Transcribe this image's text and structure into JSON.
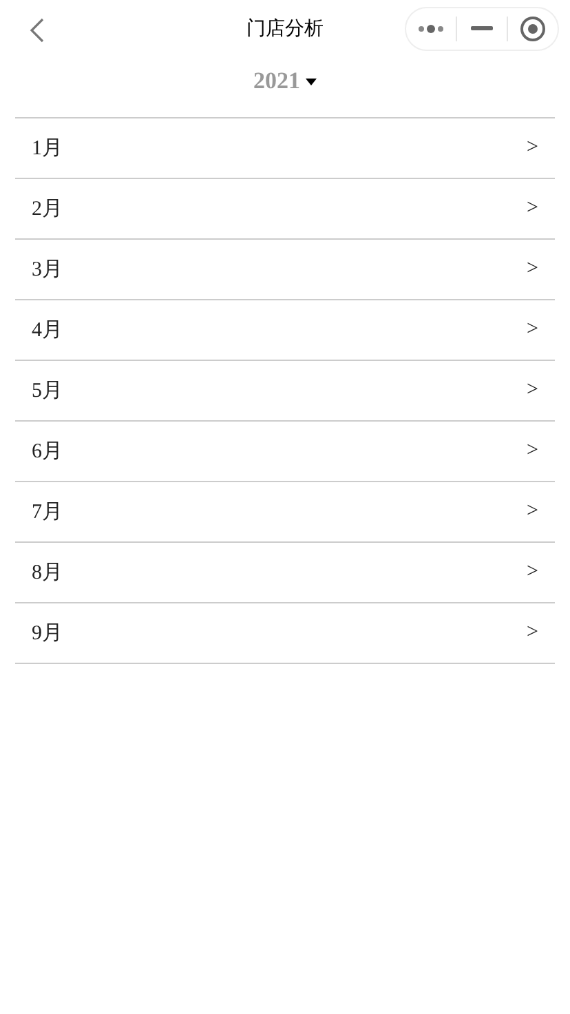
{
  "nav_bar": {
    "title": "门店分析"
  },
  "year_picker": {
    "value": "2021"
  },
  "months": [
    {
      "label": "1月",
      "arrow": ">"
    },
    {
      "label": "2月",
      "arrow": ">"
    },
    {
      "label": "3月",
      "arrow": ">"
    },
    {
      "label": "4月",
      "arrow": ">"
    },
    {
      "label": "5月",
      "arrow": ">"
    },
    {
      "label": "6月",
      "arrow": ">"
    },
    {
      "label": "7月",
      "arrow": ">"
    },
    {
      "label": "8月",
      "arrow": ">"
    },
    {
      "label": "9月",
      "arrow": ">"
    }
  ]
}
